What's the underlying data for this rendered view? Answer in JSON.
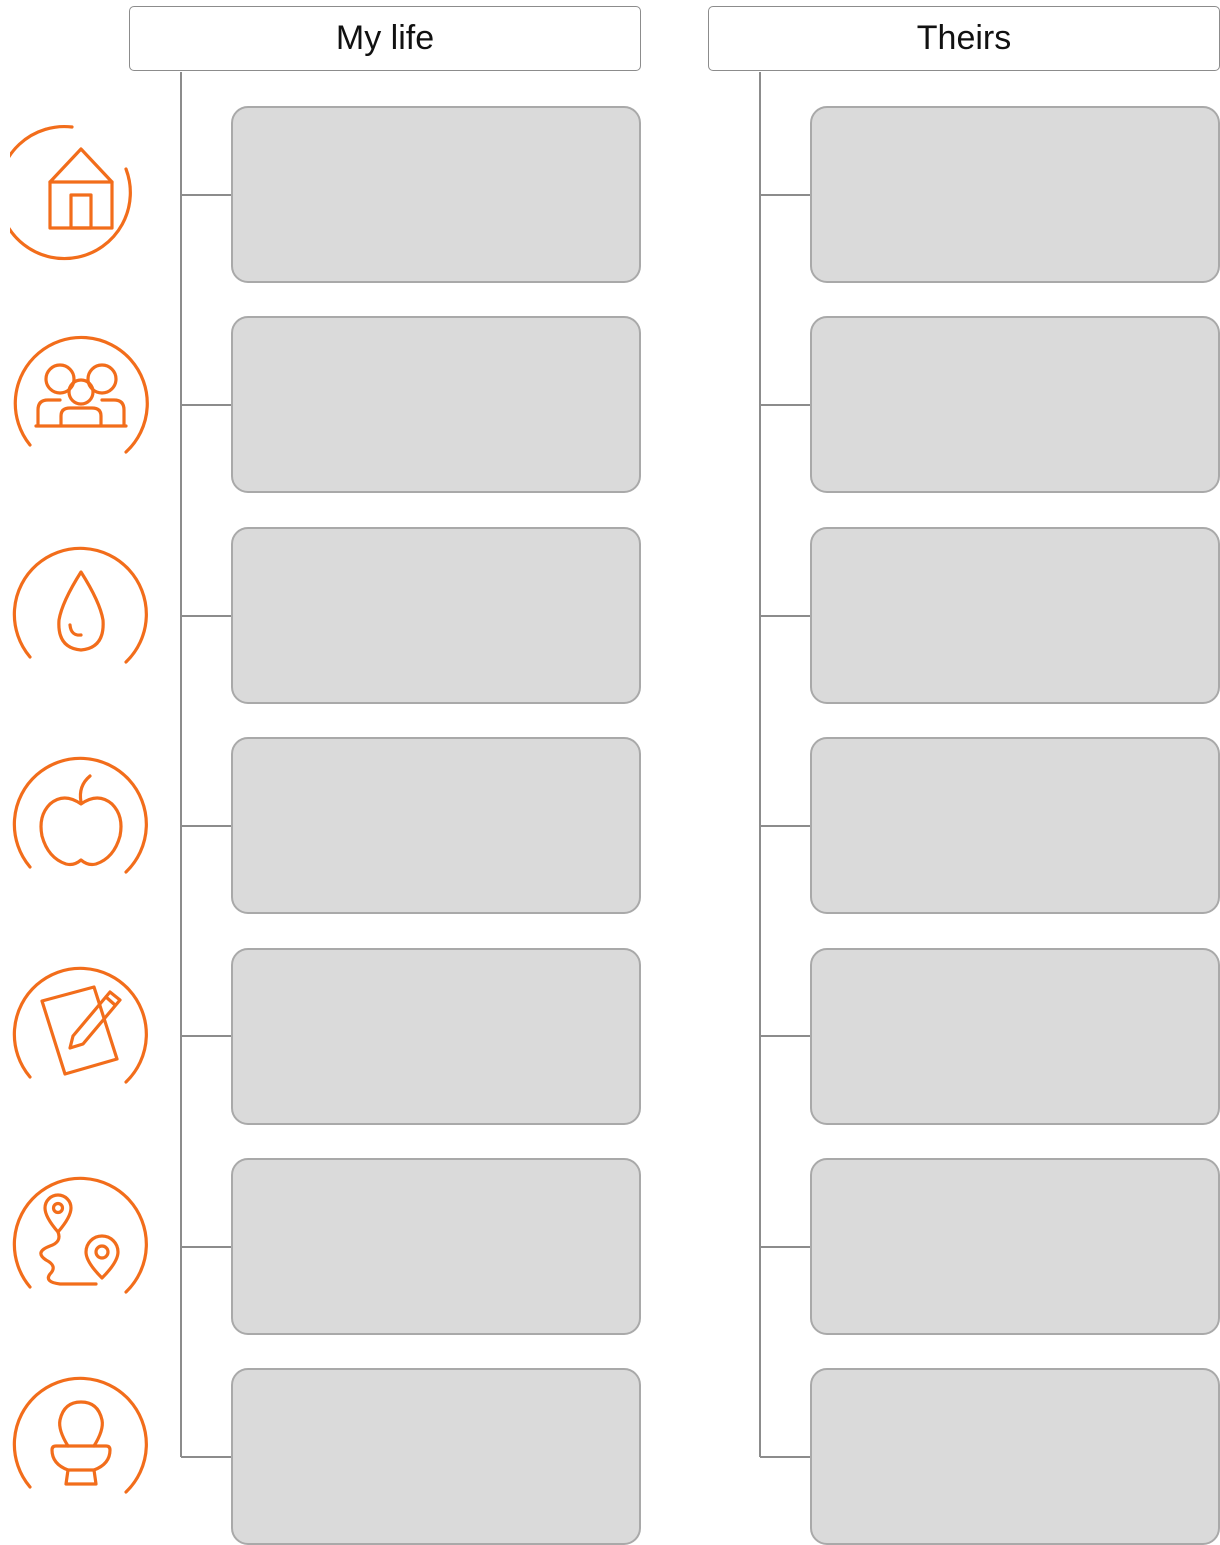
{
  "headers": {
    "left": "My life",
    "right": "Theirs"
  },
  "categories": [
    {
      "icon": "house-icon"
    },
    {
      "icon": "family-icon"
    },
    {
      "icon": "water-drop-icon"
    },
    {
      "icon": "apple-icon"
    },
    {
      "icon": "notepad-pencil-icon"
    },
    {
      "icon": "route-map-pins-icon"
    },
    {
      "icon": "toilet-icon"
    }
  ],
  "colors": {
    "accent": "#f26d1b",
    "card_fill": "#dadada",
    "card_border": "#a9a9a9",
    "line": "#8c8c8c"
  }
}
